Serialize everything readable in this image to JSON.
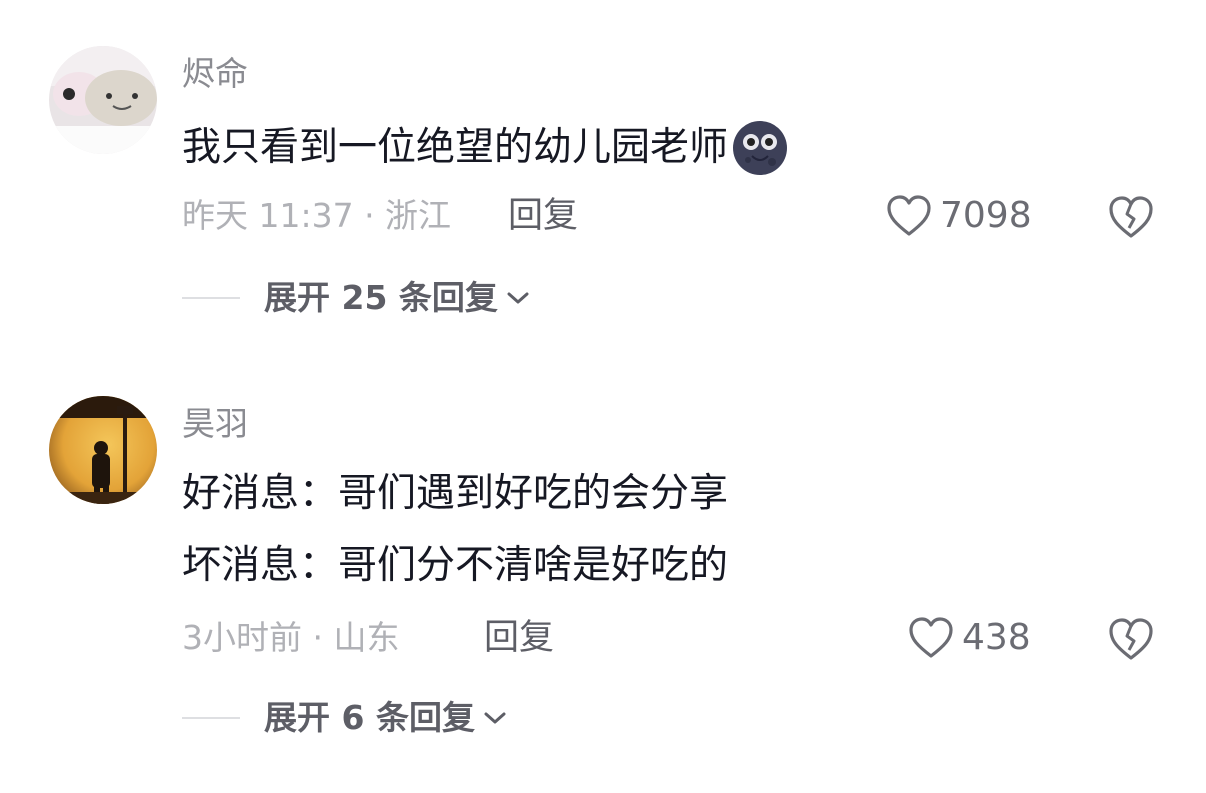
{
  "comments": [
    {
      "username": "烬命",
      "content_lines": [
        "我只看到一位绝望的幼儿园老师"
      ],
      "emoji": "new-moon-face-emoji",
      "meta": "昨天 11:37 · 浙江",
      "reply_label": "回复",
      "likes": "7098",
      "expand_label": "展开 25 条回复"
    },
    {
      "username": "昊羽",
      "content_lines": [
        "好消息：哥们遇到好吃的会分享",
        "坏消息：哥们分不清啥是好吃的"
      ],
      "meta": "3小时前 · 山东",
      "reply_label": "回复",
      "likes": "438",
      "expand_label": "展开 6 条回复"
    }
  ],
  "icons": {
    "like": "heart-outline-icon",
    "dislike": "broken-heart-icon",
    "expand": "chevron-down-icon"
  },
  "colors": {
    "username": "#8a8b91",
    "content": "#161823",
    "meta": "#b0b1b6",
    "action": "#5d5e66"
  }
}
